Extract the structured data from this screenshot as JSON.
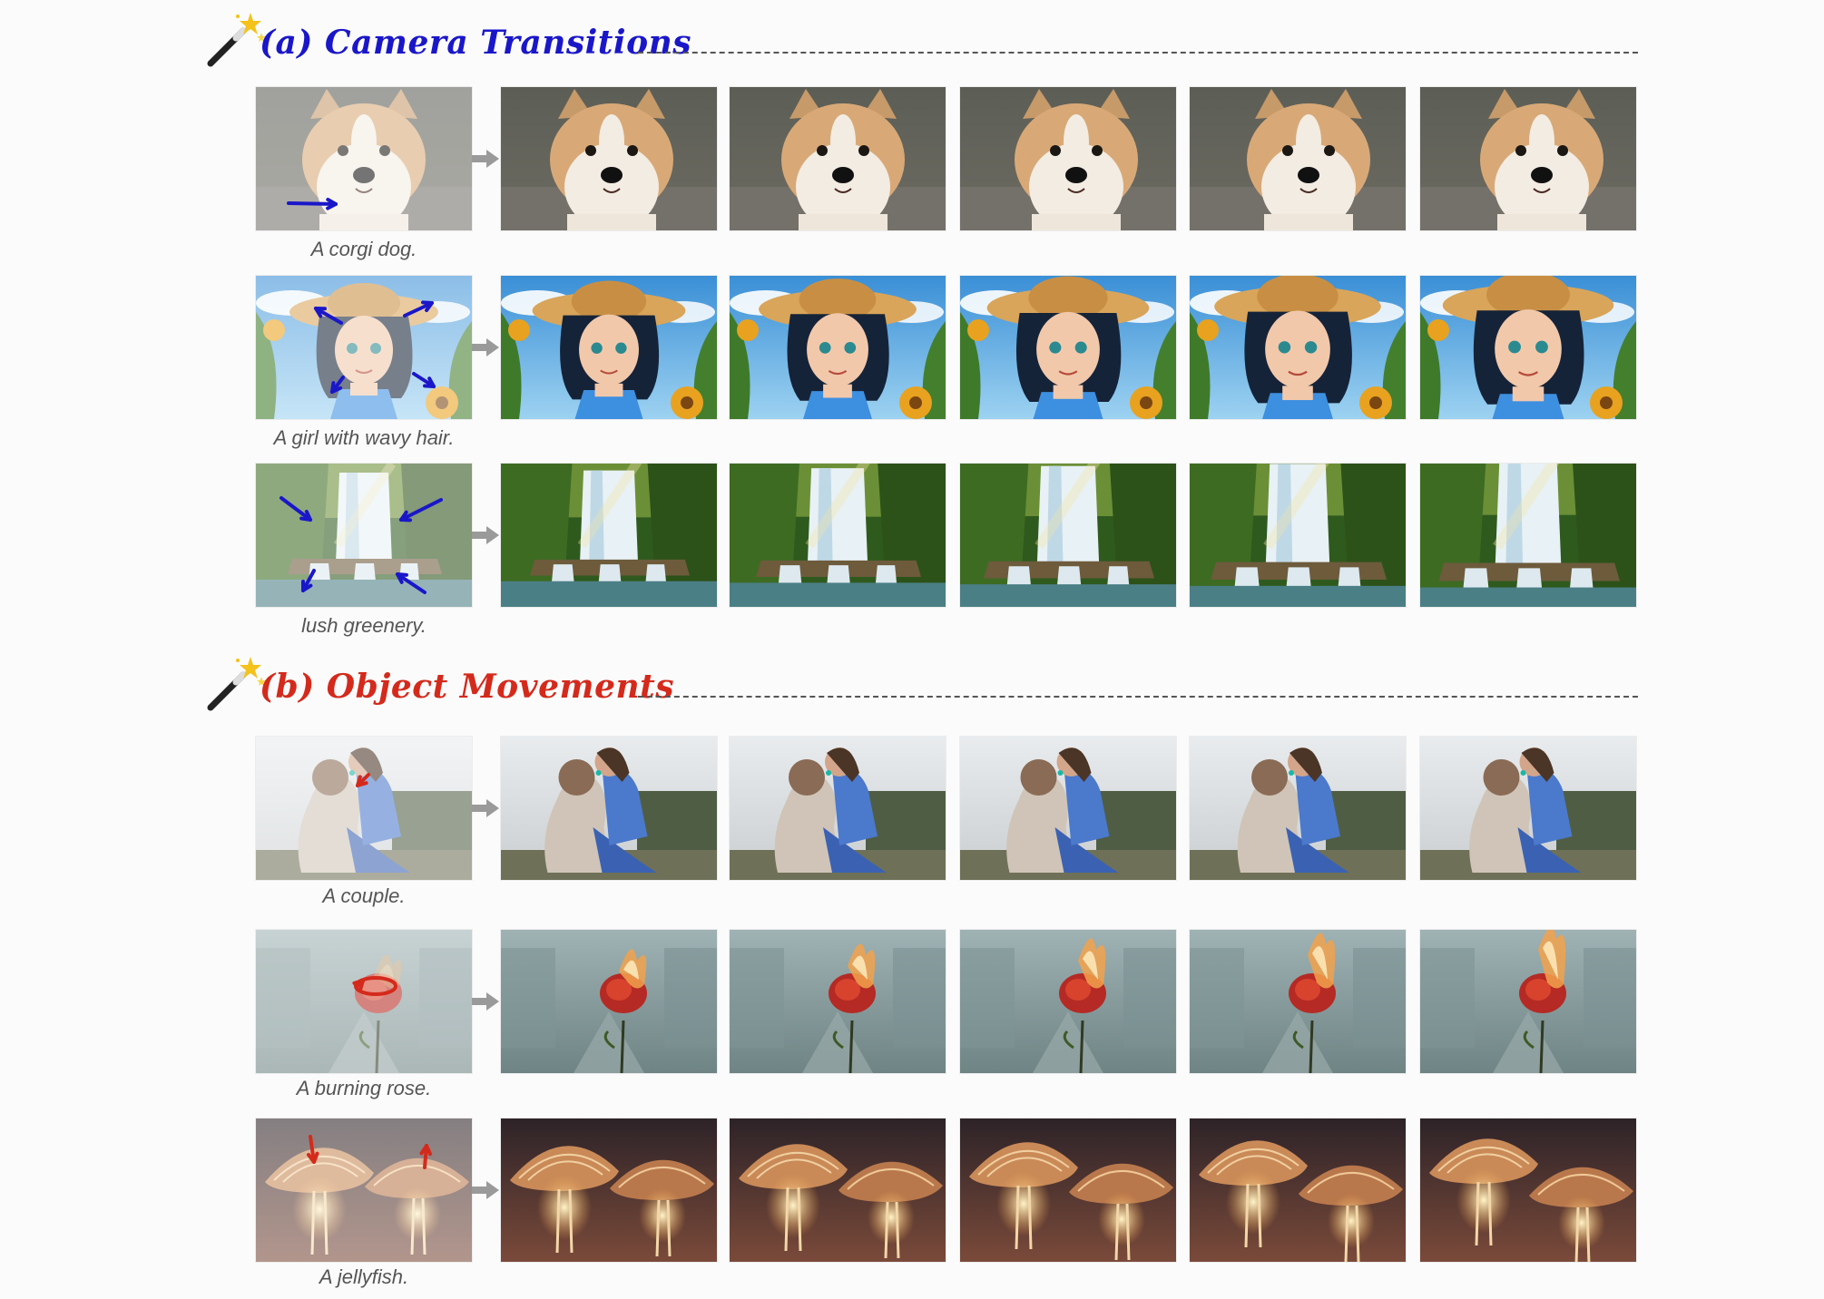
{
  "sections": [
    {
      "title": "(a) Camera Transitions",
      "color": "#1a17c9",
      "rows": [
        {
          "caption": "A corgi dog.",
          "scene": "dog",
          "motion": "camera-pan-right"
        },
        {
          "caption": "A girl with wavy hair.",
          "scene": "girl",
          "motion": "camera-zoom-out"
        },
        {
          "caption": "lush greenery.",
          "scene": "waterfall",
          "motion": "camera-zoom-in"
        }
      ]
    },
    {
      "title": "(b) Object Movements",
      "color": "#d42a1c",
      "rows": [
        {
          "caption": "A couple.",
          "scene": "couple",
          "motion": "object-kiss"
        },
        {
          "caption": "A burning rose.",
          "scene": "rose",
          "motion": "object-circle"
        },
        {
          "caption": "A jellyfish.",
          "scene": "jelly",
          "motion": "object-up-down"
        }
      ]
    }
  ],
  "colors": {
    "camera_accent": "#1a17c9",
    "object_accent": "#d42a1c",
    "caption_text": "#555555",
    "dash": "#555555"
  },
  "icons": [
    "magic-wand-icon",
    "right-arrow-icon"
  ]
}
